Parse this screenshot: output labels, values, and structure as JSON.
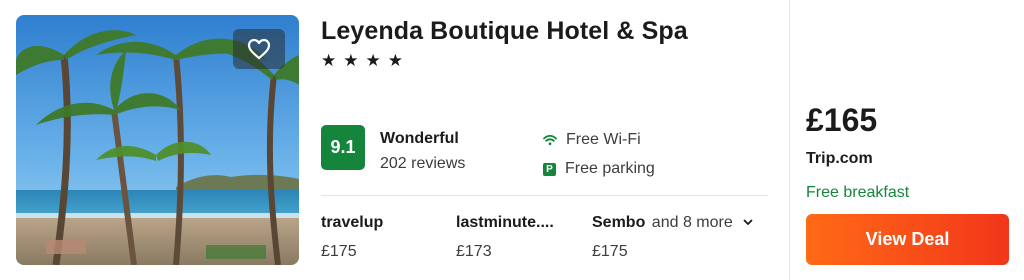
{
  "hotel": {
    "name": "Leyenda Boutique Hotel & Spa",
    "stars": 4,
    "star_glyph": "★"
  },
  "rating": {
    "score": "9.1",
    "label": "Wonderful",
    "reviews": "202 reviews",
    "badge_color": "#14853b"
  },
  "amenities": [
    {
      "icon": "wifi-icon",
      "label": "Free Wi-Fi"
    },
    {
      "icon": "parking-icon",
      "label": "Free parking",
      "icon_text": "P"
    }
  ],
  "providers": [
    {
      "name": "travelup",
      "price": "£175"
    },
    {
      "name": "lastminute....",
      "price": "£173"
    },
    {
      "name": "Sembo",
      "more": "and 8 more",
      "price": "£175"
    }
  ],
  "deal": {
    "price": "£165",
    "provider": "Trip.com",
    "perk": "Free breakfast",
    "button_label": "View Deal",
    "accent": "#ff5a1f",
    "perk_color": "#14853b"
  },
  "favorite": {
    "icon": "heart-icon"
  }
}
